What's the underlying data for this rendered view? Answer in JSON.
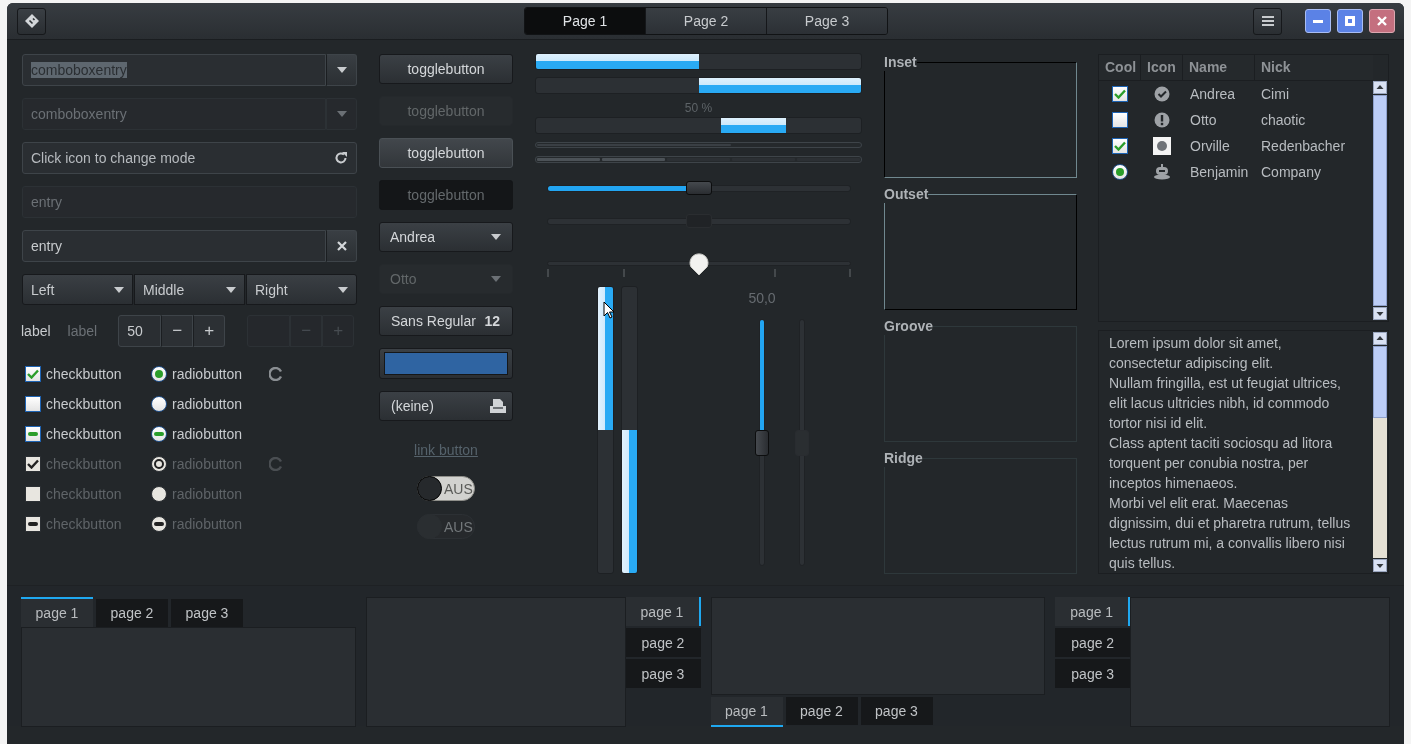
{
  "window": {
    "tabs": [
      {
        "label": "Page 1",
        "selected": true
      },
      {
        "label": "Page 2",
        "selected": false
      },
      {
        "label": "Page 3",
        "selected": false
      }
    ]
  },
  "entries": [
    {
      "kind": "combo",
      "value": "comboboxentry",
      "text_selected": true,
      "disabled": false
    },
    {
      "kind": "combo",
      "value": "comboboxentry",
      "text_selected": false,
      "disabled": true
    },
    {
      "kind": "icon",
      "placeholder": "Click icon to change mode",
      "disabled": false
    },
    {
      "kind": "plain",
      "value": "entry",
      "disabled": true
    },
    {
      "kind": "clear",
      "value": "entry",
      "disabled": false
    }
  ],
  "combo_row": [
    {
      "label": "Left"
    },
    {
      "label": "Middle"
    },
    {
      "label": "Right"
    }
  ],
  "labels": [
    {
      "text": "label",
      "disabled": false
    },
    {
      "text": "label",
      "disabled": true
    }
  ],
  "spinbuttons": [
    {
      "value": "50",
      "minus": "−",
      "plus": "+",
      "disabled": false
    },
    {
      "minus": "−",
      "plus": "+",
      "disabled": true
    }
  ],
  "check_rows": [
    {
      "check": {
        "label": "checkbutton",
        "kind": "checked",
        "disabled": false
      },
      "radio": {
        "label": "radiobutton",
        "kind": "selected",
        "disabled": false
      },
      "spinner": true
    },
    {
      "check": {
        "label": "checkbutton",
        "kind": "unchecked",
        "disabled": false
      },
      "radio": {
        "label": "radiobutton",
        "kind": "unselected",
        "disabled": false
      },
      "spinner": false
    },
    {
      "check": {
        "label": "checkbutton",
        "kind": "inconsistent",
        "disabled": false
      },
      "radio": {
        "label": "radiobutton",
        "kind": "inconsistent",
        "disabled": false
      },
      "spinner": false
    },
    {
      "check": {
        "label": "checkbutton",
        "kind": "checked",
        "disabled": true
      },
      "radio": {
        "label": "radiobutton",
        "kind": "selected",
        "disabled": true
      },
      "spinner": true
    },
    {
      "check": {
        "label": "checkbutton",
        "kind": "unchecked",
        "disabled": true
      },
      "radio": {
        "label": "radiobutton",
        "kind": "unselected",
        "disabled": true
      },
      "spinner": false
    },
    {
      "check": {
        "label": "checkbutton",
        "kind": "inconsistent",
        "disabled": true
      },
      "radio": {
        "label": "radiobutton",
        "kind": "inconsistent",
        "disabled": true
      },
      "spinner": false
    }
  ],
  "buttons": [
    {
      "kind": "toggle",
      "label": "togglebutton",
      "active": false,
      "disabled": false
    },
    {
      "kind": "toggle",
      "label": "togglebutton",
      "active": false,
      "disabled": true
    },
    {
      "kind": "toggle",
      "label": "togglebutton",
      "active": true,
      "disabled": false
    },
    {
      "kind": "toggle",
      "label": "togglebutton",
      "active": true,
      "disabled": true
    },
    {
      "kind": "combo",
      "label": "Andrea",
      "disabled": false
    },
    {
      "kind": "combo",
      "label": "Otto",
      "disabled": true
    },
    {
      "kind": "font",
      "label": "Sans Regular",
      "size": "12"
    },
    {
      "kind": "color",
      "color": "#2f64a2"
    },
    {
      "kind": "file",
      "label": "(keine)"
    },
    {
      "kind": "link",
      "label": "link button"
    },
    {
      "kind": "switch",
      "label": "AUS",
      "on": false,
      "disabled": false
    },
    {
      "kind": "switch",
      "label": "AUS",
      "on": false,
      "disabled": true
    }
  ],
  "progress": [
    {
      "kind": "bar",
      "level": 0.5,
      "inverted": false
    },
    {
      "kind": "bar",
      "level": 0.5,
      "inverted": true
    },
    {
      "kind": "pulse",
      "text": "50 %"
    }
  ],
  "level_bars": [
    {
      "kind": "continuous",
      "level": 0.6
    },
    {
      "kind": "discrete",
      "level": 0.4
    }
  ],
  "scales": [
    {
      "kind": "plain",
      "level": 0.5,
      "disabled": false
    },
    {
      "kind": "plain",
      "level": 0.5,
      "disabled": true
    },
    {
      "kind": "marks",
      "level": 0.5,
      "disabled": false
    }
  ],
  "vertical_progress": [
    {
      "level": 0.5,
      "inverted": false
    },
    {
      "level": 0.5,
      "inverted": true
    }
  ],
  "vertical_scales": [
    {
      "value": "50,0",
      "level": 0.5,
      "disabled": false
    },
    {
      "level": 0.5,
      "disabled": true
    }
  ],
  "frames": [
    {
      "label": "Inset",
      "kind": "inset"
    },
    {
      "label": "Outset",
      "kind": "outset"
    },
    {
      "label": "Groove",
      "kind": "groove"
    },
    {
      "label": "Ridge",
      "kind": "ridge"
    }
  ],
  "tree": {
    "columns": [
      "Cool",
      "Icon",
      "Name",
      "Nick"
    ],
    "rows": [
      {
        "cool": {
          "kind": "check",
          "checked": true
        },
        "icon": {
          "kind": "check"
        },
        "name": "Andrea",
        "nick": "Cimi"
      },
      {
        "cool": {
          "kind": "check",
          "checked": false
        },
        "icon": {
          "kind": "warning"
        },
        "name": "Otto",
        "nick": "chaotic"
      },
      {
        "cool": {
          "kind": "check",
          "checked": true
        },
        "icon": {
          "kind": "image"
        },
        "name": "Orville",
        "nick": "Redenbacher"
      },
      {
        "cool": {
          "kind": "radio",
          "checked": true
        },
        "icon": {
          "kind": "robot"
        },
        "name": "Benjamin",
        "nick": "Company"
      }
    ]
  },
  "text_view": {
    "paragraphs": [
      "Lorem ipsum dolor sit amet, consectetur adipiscing elit.",
      "Nullam fringilla, est ut feugiat ultrices, elit lacus ultricies nibh, id commodo tortor nisi id elit.",
      "Class aptent taciti sociosqu ad litora torquent per conubia nostra, per inceptos himenaeos.",
      "Morbi vel elit erat. Maecenas dignissim, dui et pharetra rutrum, tellus lectus rutrum mi, a convallis libero nisi quis tellus."
    ]
  },
  "notebooks": [
    {
      "kind": "top",
      "tabs": [
        {
          "label": "page 1",
          "selected": true
        },
        {
          "label": "page 2",
          "selected": false
        },
        {
          "label": "page 3",
          "selected": false
        }
      ]
    },
    {
      "kind": "right",
      "tabs": [
        {
          "label": "page 1",
          "selected": true
        },
        {
          "label": "page 2",
          "selected": false
        },
        {
          "label": "page 3",
          "selected": false
        }
      ]
    },
    {
      "kind": "bottom",
      "tabs": [
        {
          "label": "page 1",
          "selected": true
        },
        {
          "label": "page 2",
          "selected": false
        },
        {
          "label": "page 3",
          "selected": false
        }
      ]
    },
    {
      "kind": "left",
      "tabs": [
        {
          "label": "page 1",
          "selected": true
        },
        {
          "label": "page 2",
          "selected": false
        },
        {
          "label": "page 3",
          "selected": false
        }
      ]
    }
  ]
}
